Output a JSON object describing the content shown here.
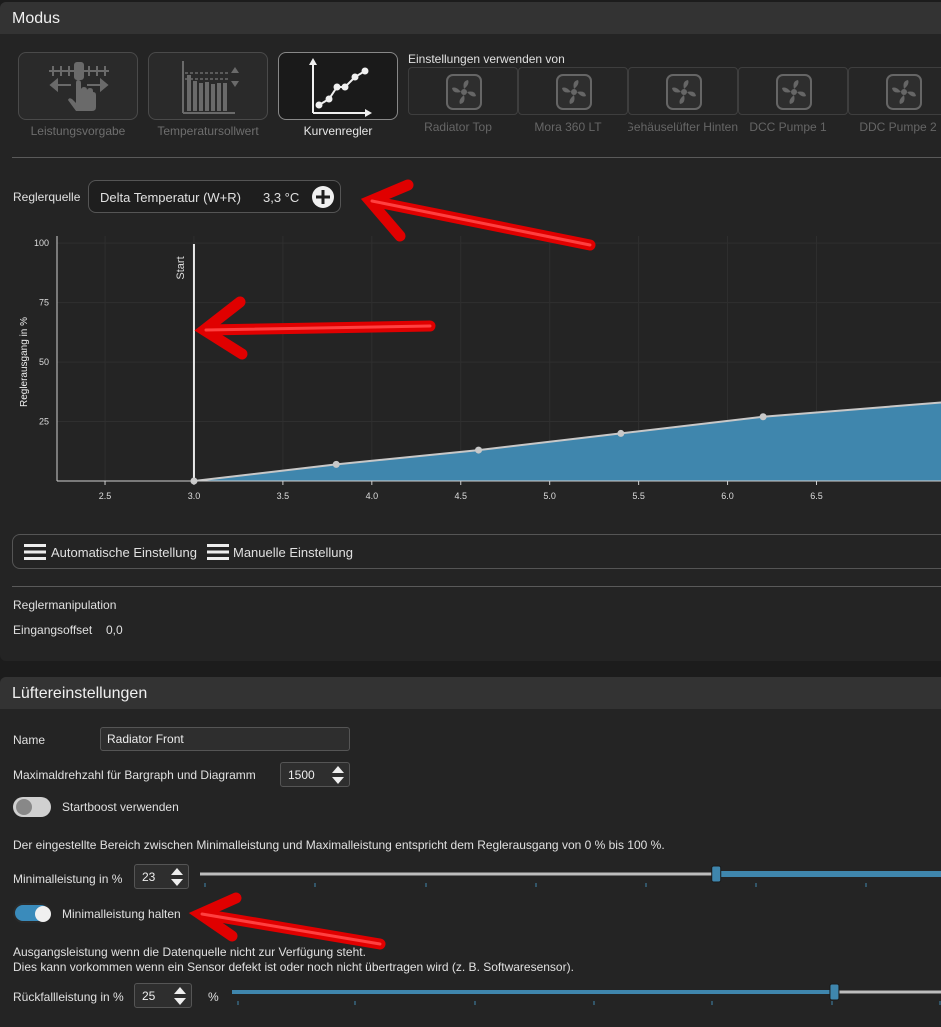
{
  "modus": {
    "title": "Modus",
    "modes": [
      {
        "label": "Leistungsvorgabe",
        "icon": "power-preset-icon",
        "active": false
      },
      {
        "label": "Temperatursollwert",
        "icon": "temperature-setpoint-icon",
        "active": false
      },
      {
        "label": "Kurvenregler",
        "icon": "curve-controller-icon",
        "active": true
      }
    ],
    "sources_label": "Einstellungen verwenden von",
    "sources": [
      "Radiator Top",
      "Mora 360 LT",
      "Gehäuselüfter Hinten",
      "DCC Pumpe 1",
      "DDC Pumpe 2"
    ],
    "controller_source_label": "Reglerquelle",
    "controller_source_name": "Delta Temperatur (W+R)",
    "controller_source_value": "3,3 °C",
    "auto_label": "Automatische Einstellung",
    "manual_label": "Manuelle Einstellung",
    "manipulation_label": "Reglermanipulation",
    "input_offset_label": "Eingangsoffset",
    "input_offset_value": "0,0"
  },
  "chart_data": {
    "type": "area",
    "ylabel": "Reglerausgang in %",
    "x_ticks": [
      "2.5",
      "3.0",
      "3.5",
      "4.0",
      "4.5",
      "5.0",
      "5.5",
      "6.0",
      "6.5"
    ],
    "y_ticks": [
      "25",
      "50",
      "75",
      "100"
    ],
    "xlim": [
      2.23,
      7.2
    ],
    "ylim": [
      0,
      103
    ],
    "start_label": "Start",
    "start_x": 3.0,
    "points": [
      {
        "x": 3.0,
        "y": 0
      },
      {
        "x": 3.8,
        "y": 7
      },
      {
        "x": 4.6,
        "y": 13
      },
      {
        "x": 5.4,
        "y": 20
      },
      {
        "x": 6.2,
        "y": 27
      }
    ],
    "line_end": {
      "x": 7.2,
      "y": 33
    },
    "fill_color": "#3f86ad",
    "line_color": "#c8c8c8"
  },
  "fan": {
    "title": "Lüftereinstellungen",
    "name_label": "Name",
    "name_value": "Radiator Front",
    "maxrpm_label": "Maximaldrehzahl für Bargraph und Diagramm",
    "maxrpm_value": "1500",
    "startboost_label": "Startboost verwenden",
    "startboost_on": false,
    "range_note": "Der eingestellte Bereich zwischen Minimalleistung und Maximalleistung entspricht dem Reglerausgang von 0 % bis 100 %.",
    "min_power_label": "Minimalleistung in %",
    "min_power_value": "23",
    "min_power_fraction": 0.696,
    "hold_min_label": "Minimalleistung halten",
    "hold_min_on": true,
    "fallback_note_1": "Ausgangsleistung wenn die Datenquelle nicht zur Verfügung steht.",
    "fallback_note_2": "Dies kann vorkommen wenn ein Sensor defekt ist oder noch nicht übertragen wird (z. B. Softwaresensor).",
    "fallback_label": "Rückfallleistung in %",
    "fallback_value": "25",
    "fallback_unit": "%",
    "fallback_fraction": 0.849
  },
  "colors": {
    "accent": "#3f86ad",
    "arrow": "#ff0000"
  }
}
